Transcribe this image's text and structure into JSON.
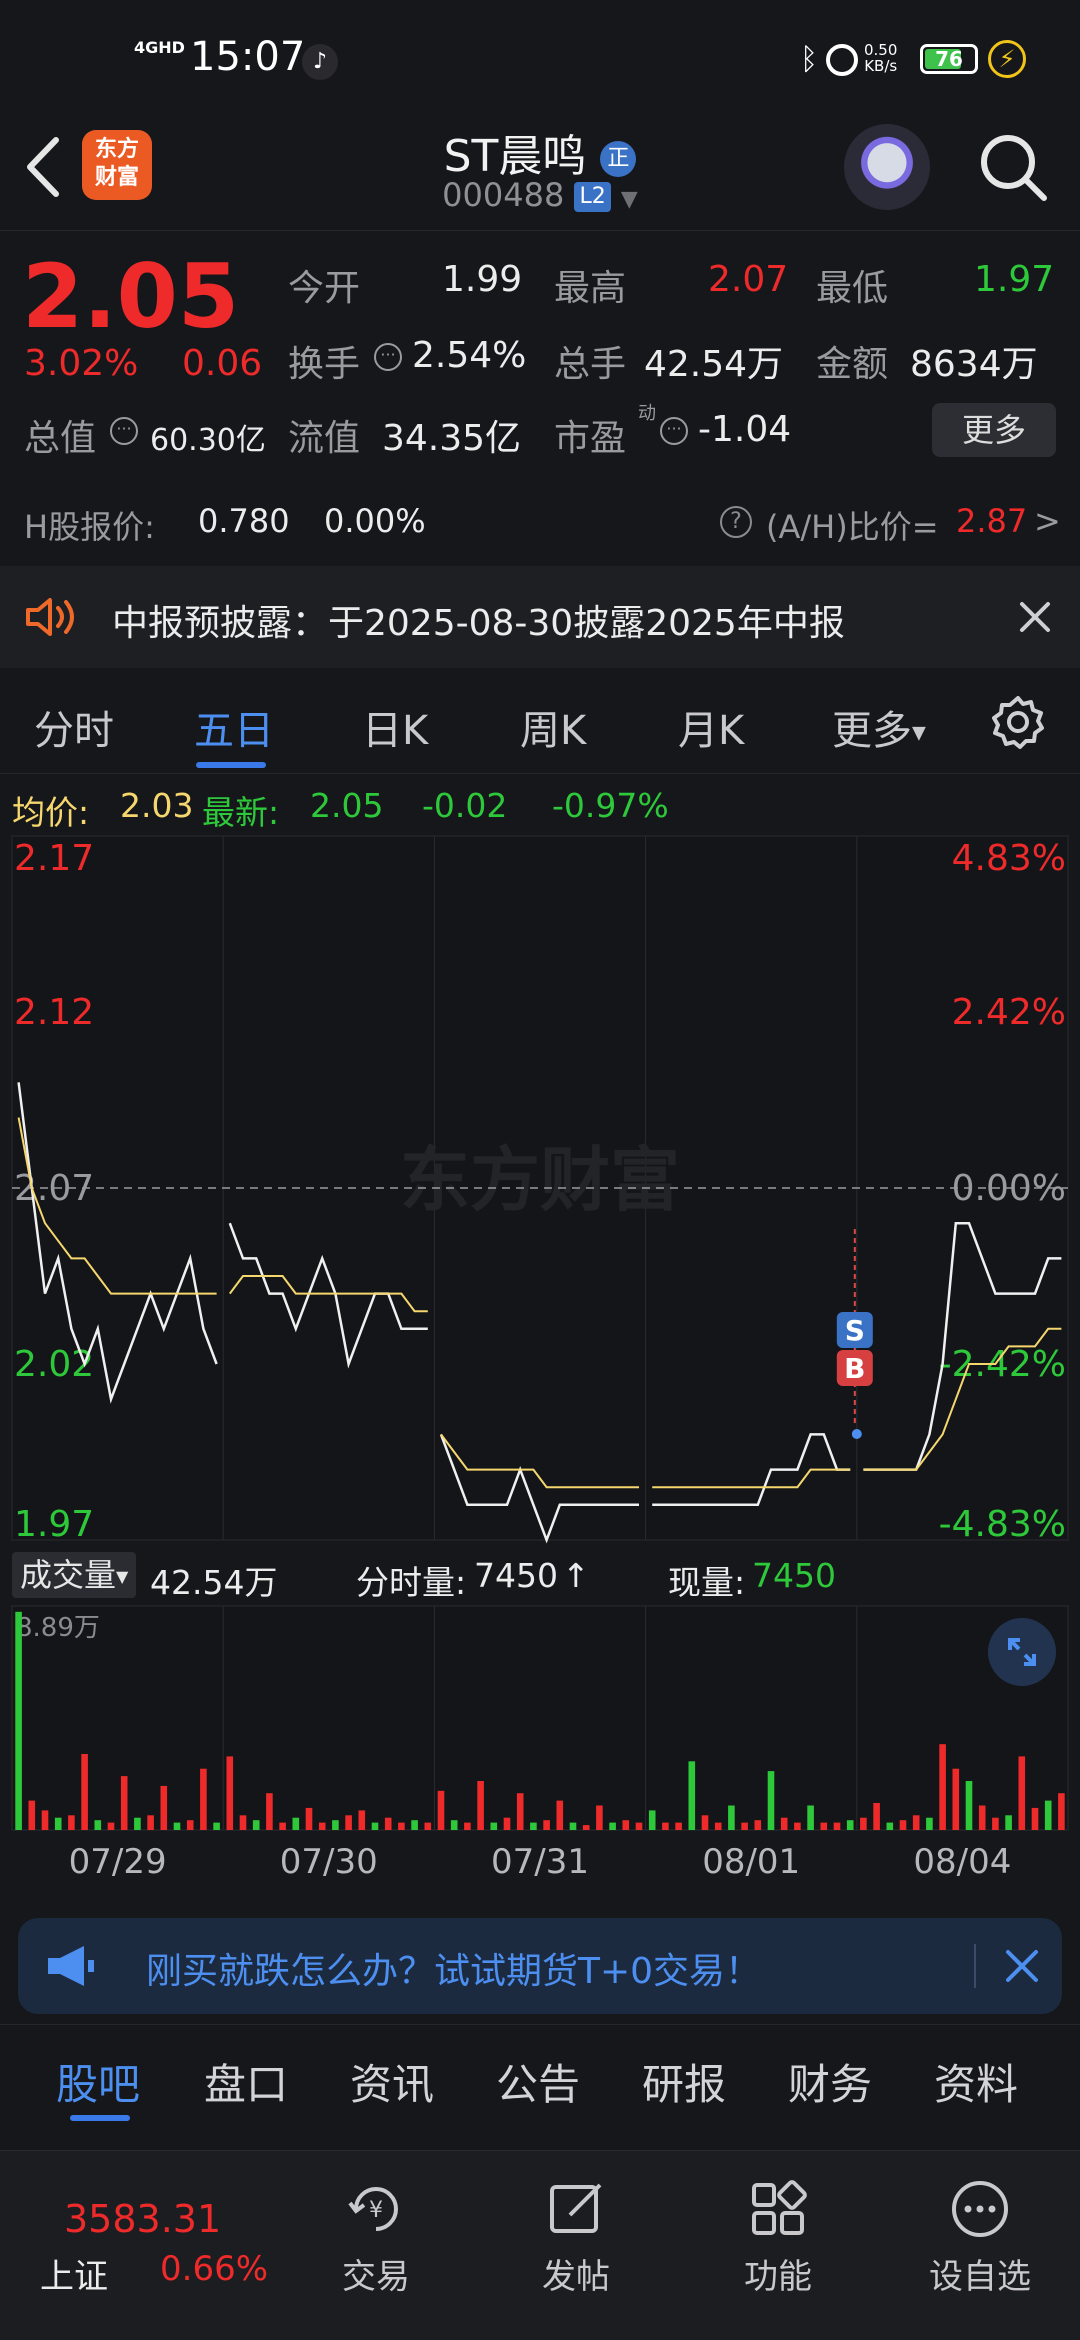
{
  "status_bar": {
    "time": "15:07",
    "network": "4GHD",
    "speed_value": "0.50",
    "speed_unit": "KB/s",
    "battery": "76",
    "battery_level": 0.76
  },
  "header": {
    "logo_line1": "东方",
    "logo_line2": "财富",
    "stock_name": "ST晨鸣",
    "badge": "正",
    "stock_code": "000488",
    "level": "L2"
  },
  "quote": {
    "price": "2.05",
    "change_pct": "3.02%",
    "change_abs": "0.06",
    "open_label": "今开",
    "open_value": "1.99",
    "high_label": "最高",
    "high_value": "2.07",
    "low_label": "最低",
    "low_value": "1.97",
    "turnover_label": "换手",
    "turnover_value": "2.54%",
    "volume_label": "总手",
    "volume_value": "42.54万",
    "amount_label": "金额",
    "amount_value": "8634万",
    "total_cap_label": "总值",
    "total_cap_value": "60.30亿",
    "float_cap_label": "流值",
    "float_cap_value": "34.35亿",
    "pe_label": "市盈",
    "pe_sup": "动",
    "pe_value": "-1.04",
    "more_label": "更多"
  },
  "h_share": {
    "label": "H股报价:",
    "price": "0.780",
    "change": "0.00%",
    "ratio_label": "(A/H)比价=",
    "ratio_value": "2.87",
    "arrow": ">"
  },
  "notice": {
    "text": "中报预披露：于2025-08-30披露2025年中报"
  },
  "chart_tabs": [
    "分时",
    "五日",
    "日K",
    "周K",
    "月K",
    "更多"
  ],
  "avg_row": {
    "avg_label": "均价:",
    "avg_value": "2.03",
    "latest_label": "最新:",
    "latest_value": "2.05",
    "change_abs": "-0.02",
    "change_pct": "-0.97%"
  },
  "volume_row": {
    "selector": "成交量",
    "total": "42.54万",
    "period_label": "分时量:",
    "period_value": "7450",
    "period_arrow": "↑",
    "current_label": "现量:",
    "current_value": "7450",
    "max_label": "8.89万"
  },
  "watermark": "东方财富",
  "chart_data": {
    "type": "line",
    "title": "",
    "y_left_ticks": [
      "2.17",
      "2.12",
      "2.07",
      "2.02",
      "1.97"
    ],
    "y_right_ticks": [
      "4.83%",
      "2.42%",
      "0.00%",
      "-2.42%",
      "-4.83%"
    ],
    "ylim": [
      1.97,
      2.17
    ],
    "prev_close": 2.07,
    "x_labels": [
      "07/29",
      "07/30",
      "07/31",
      "08/01",
      "08/04"
    ],
    "markers": [
      "S",
      "B"
    ],
    "series": [
      {
        "values": [
          2.1,
          2.07,
          2.04,
          2.05,
          2.03,
          2.02,
          2.03,
          2.01,
          2.02,
          2.03,
          2.04,
          2.03,
          2.04,
          2.05,
          2.03,
          2.02,
          2.06,
          2.05,
          2.05,
          2.04,
          2.04,
          2.03,
          2.04,
          2.05,
          2.04,
          2.02,
          2.03,
          2.04,
          2.04,
          2.03,
          2.03,
          2.03,
          2.0,
          1.99,
          1.98,
          1.98,
          1.98,
          1.98,
          1.99,
          1.98,
          1.97,
          1.98,
          1.98,
          1.98,
          1.98,
          1.98,
          1.98,
          1.98,
          1.98,
          1.98,
          1.98,
          1.98,
          1.98,
          1.98,
          1.98,
          1.98,
          1.98,
          1.99,
          1.99,
          1.99,
          2.0,
          2.0,
          1.99,
          1.99,
          1.99,
          1.99,
          1.99,
          1.99,
          1.99,
          2.0,
          2.02,
          2.06,
          2.06,
          2.05,
          2.04,
          2.04,
          2.04,
          2.04,
          2.05,
          2.05
        ]
      },
      {
        "values": [
          2.09,
          2.07,
          2.06,
          2.055,
          2.05,
          2.05,
          2.045,
          2.04,
          2.04,
          2.04,
          2.04,
          2.04,
          2.04,
          2.04,
          2.04,
          2.04,
          2.04,
          2.045,
          2.045,
          2.045,
          2.045,
          2.04,
          2.04,
          2.04,
          2.04,
          2.04,
          2.04,
          2.04,
          2.04,
          2.04,
          2.035,
          2.035,
          2.0,
          1.995,
          1.99,
          1.99,
          1.99,
          1.99,
          1.99,
          1.99,
          1.985,
          1.985,
          1.985,
          1.985,
          1.985,
          1.985,
          1.985,
          1.985,
          1.985,
          1.985,
          1.985,
          1.985,
          1.985,
          1.985,
          1.985,
          1.985,
          1.985,
          1.985,
          1.985,
          1.985,
          1.99,
          1.99,
          1.99,
          1.99,
          1.99,
          1.99,
          1.99,
          1.99,
          1.99,
          1.995,
          2.0,
          2.01,
          2.02,
          2.02,
          2.02,
          2.025,
          2.025,
          2.025,
          2.03,
          2.03
        ]
      }
    ],
    "volume_ylim": [
      0,
      8.89
    ],
    "volume_values": [
      8.9,
      1.2,
      0.8,
      0.5,
      0.6,
      3.1,
      0.4,
      0.3,
      2.2,
      0.5,
      0.6,
      1.8,
      0.3,
      0.4,
      2.5,
      0.3,
      3.0,
      0.6,
      0.4,
      1.5,
      0.3,
      0.5,
      0.9,
      0.3,
      0.4,
      0.6,
      0.8,
      0.3,
      0.5,
      0.3,
      0.4,
      0.3,
      1.6,
      0.4,
      0.3,
      2.0,
      0.3,
      0.5,
      1.5,
      0.3,
      0.4,
      1.2,
      0.3,
      0.2,
      1.0,
      0.3,
      0.4,
      0.3,
      0.8,
      0.3,
      0.3,
      2.8,
      0.6,
      0.3,
      1.0,
      0.3,
      0.4,
      2.4,
      0.5,
      0.3,
      1.0,
      0.3,
      0.3,
      0.4,
      0.5,
      1.1,
      0.3,
      0.4,
      0.6,
      0.5,
      3.5,
      2.5,
      2.0,
      1.0,
      0.5,
      0.6,
      3.0,
      0.9,
      1.2,
      1.5
    ]
  },
  "ad": {
    "text": "刚买就跌怎么办？试试期货T+0交易！"
  },
  "sub_tabs": [
    "股吧",
    "盘口",
    "资讯",
    "公告",
    "研报",
    "财务",
    "资料"
  ],
  "bottom_nav": {
    "index_value": "3583.31",
    "index_name": "上证",
    "index_change": "0.66%",
    "items": [
      "交易",
      "发帖",
      "功能",
      "设自选"
    ]
  },
  "colors": {
    "up": "#ee2a2a",
    "down": "#2ec93a",
    "accent": "#4d8ff0",
    "avg_line": "#f5d76e",
    "background": "#16171b"
  }
}
